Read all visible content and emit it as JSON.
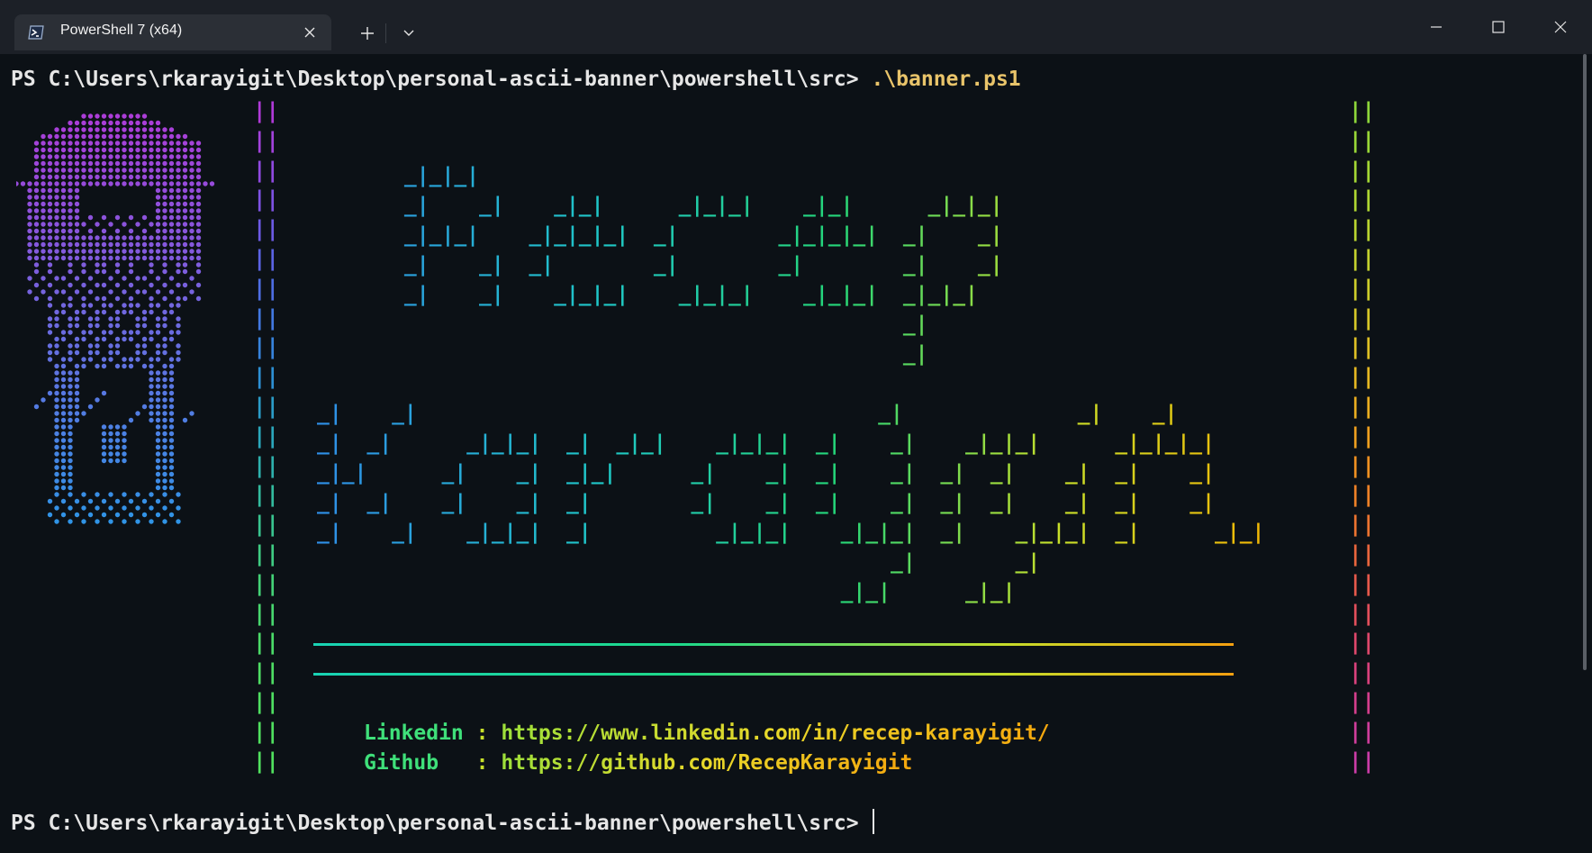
{
  "window": {
    "tab_title": "PowerShell 7 (x64)",
    "icons": {
      "tab": "powershell-icon",
      "close_tab": "close-icon",
      "new_tab": "plus-icon",
      "dropdown": "chevron-down-icon",
      "minimize": "minimize-icon",
      "maximize": "maximize-icon",
      "close": "close-icon"
    }
  },
  "terminal": {
    "prompt": "PS C:\\Users\\rkarayigit\\Desktop\\personal-ascii-banner\\powershell\\src>",
    "command": ".\\banner.ps1",
    "banner": {
      "left_border": "||",
      "right_border": "||",
      "big_text_lines": [
        "",
        "",
        "       _|_|_|",
        "       _|    _|    _|_|      _|_|_|    _|_|      _|_|_|",
        "       _|_|_|    _|_|_|_|  _|        _|_|_|_|  _|    _|",
        "       _|    _|  _|        _|        _|        _|    _|",
        "       _|    _|    _|_|_|    _|_|_|    _|_|_|  _|_|_|",
        "                                               _|",
        "                                               _|",
        "",
        "_|    _|                                     _|              _|    _|",
        "_|  _|      _|_|_|  _|  _|_|    _|_|_|  _|    _|    _|_|_|      _|_|_|_|",
        "_|_|      _|    _|  _|_|      _|    _|  _|    _|  _|  _|    _|  _|    _|",
        "_|  _|    _|    _|  _|        _|    _|  _|    _|  _|  _|    _|  _|    _|",
        "_|    _|    _|_|_|  _|          _|_|_|    _|_|_|  _|    _|_|_|  _|      _|_|",
        "                                              _|        _|",
        "                                          _|_|      _|_|"
      ],
      "links": [
        {
          "label": "Linkedin",
          "sep": ":",
          "url": "https://www.linkedin.com/in/recep-karayigit/"
        },
        {
          "label": "Github  ",
          "sep": ":",
          "url": "https://github.com/RecepKarayigit"
        }
      ]
    },
    "colors": {
      "background": "#0c1116",
      "portrait_top": "#b03ad8",
      "portrait_bottom": "#2f95e6",
      "accent_yellow": "#e9c46a"
    }
  }
}
